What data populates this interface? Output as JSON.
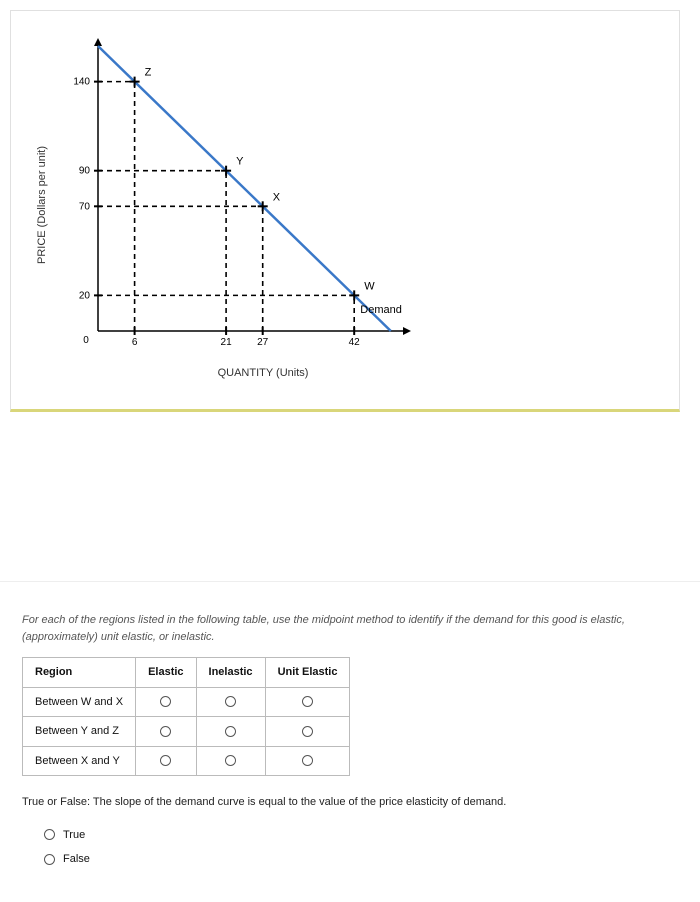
{
  "chart_data": {
    "type": "line",
    "title": "",
    "xlabel": "QUANTITY (Units)",
    "ylabel": "PRICE (Dollars per unit)",
    "xlim": [
      0,
      50
    ],
    "ylim": [
      0,
      160
    ],
    "x_ticks": [
      0,
      6,
      21,
      27,
      42
    ],
    "y_ticks": [
      0,
      20,
      70,
      90,
      140
    ],
    "series": [
      {
        "name": "Demand",
        "x": [
          0,
          48
        ],
        "y": [
          160,
          0
        ]
      }
    ],
    "points": [
      {
        "label": "Z",
        "x": 6,
        "y": 140
      },
      {
        "label": "Y",
        "x": 21,
        "y": 90
      },
      {
        "label": "X",
        "x": 27,
        "y": 70
      },
      {
        "label": "W",
        "x": 42,
        "y": 20
      }
    ],
    "legend": "Demand"
  },
  "question1": {
    "prompt": "For each of the regions listed in the following table, use the midpoint method to identify if the demand for this good is elastic, (approximately) unit elastic, or inelastic.",
    "headers": [
      "Region",
      "Elastic",
      "Inelastic",
      "Unit Elastic"
    ],
    "rows": [
      {
        "label": "Between W and X"
      },
      {
        "label": "Between Y and Z"
      },
      {
        "label": "Between X and Y"
      }
    ]
  },
  "question2": {
    "prompt": "True or False: The slope of the demand curve is equal to the value of the price elasticity of demand.",
    "options": [
      "True",
      "False"
    ]
  }
}
